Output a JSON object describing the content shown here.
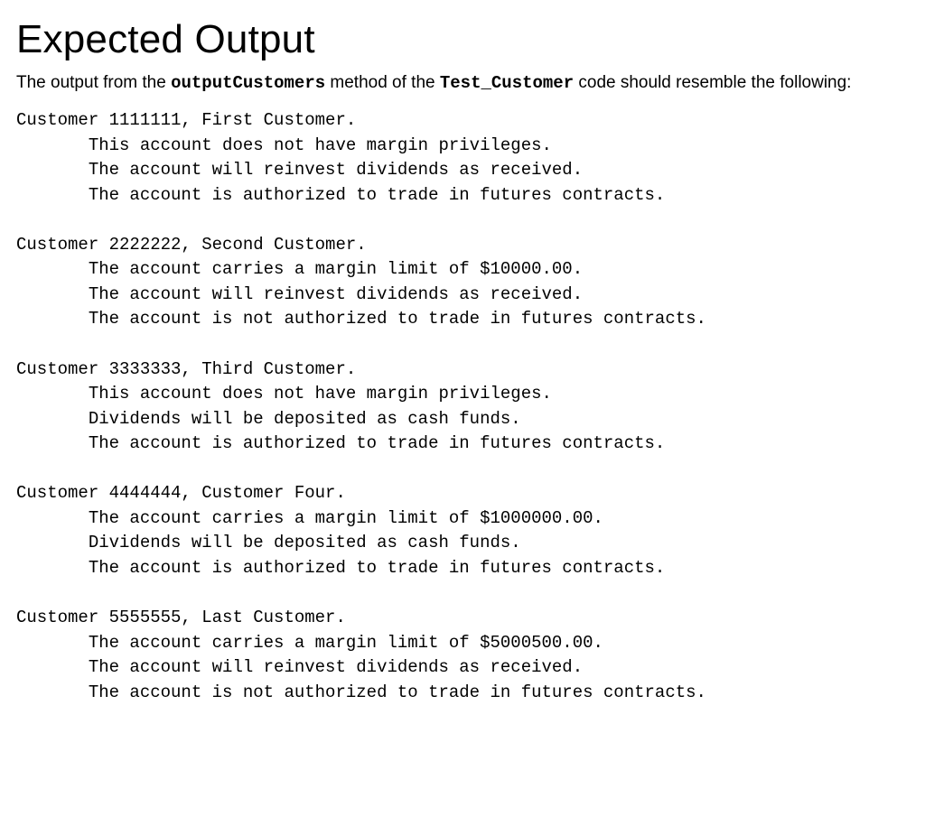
{
  "heading": "Expected Output",
  "intro": {
    "prefix": "The output from the ",
    "method": "outputCustomers",
    "mid": " method of the ",
    "class": "Test_Customer",
    "suffix": " code should resemble the following:"
  },
  "customers": [
    {
      "header": "Customer 1111111, First Customer.",
      "lines": [
        "This account does not have margin privileges.",
        "The account will reinvest dividends as received.",
        "The account is authorized to trade in futures contracts."
      ]
    },
    {
      "header": "Customer 2222222, Second Customer.",
      "lines": [
        "The account carries a margin limit of $10000.00.",
        "The account will reinvest dividends as received.",
        "The account is not authorized to trade in futures contracts."
      ]
    },
    {
      "header": "Customer 3333333, Third Customer.",
      "lines": [
        "This account does not have margin privileges.",
        "Dividends will be deposited as cash funds.",
        "The account is authorized to trade in futures contracts."
      ]
    },
    {
      "header": "Customer 4444444, Customer Four.",
      "lines": [
        "The account carries a margin limit of $1000000.00.",
        "Dividends will be deposited as cash funds.",
        "The account is authorized to trade in futures contracts."
      ]
    },
    {
      "header": "Customer 5555555, Last Customer.",
      "lines": [
        "The account carries a margin limit of $5000500.00.",
        "The account will reinvest dividends as received.",
        "The account is not authorized to trade in futures contracts."
      ]
    }
  ]
}
